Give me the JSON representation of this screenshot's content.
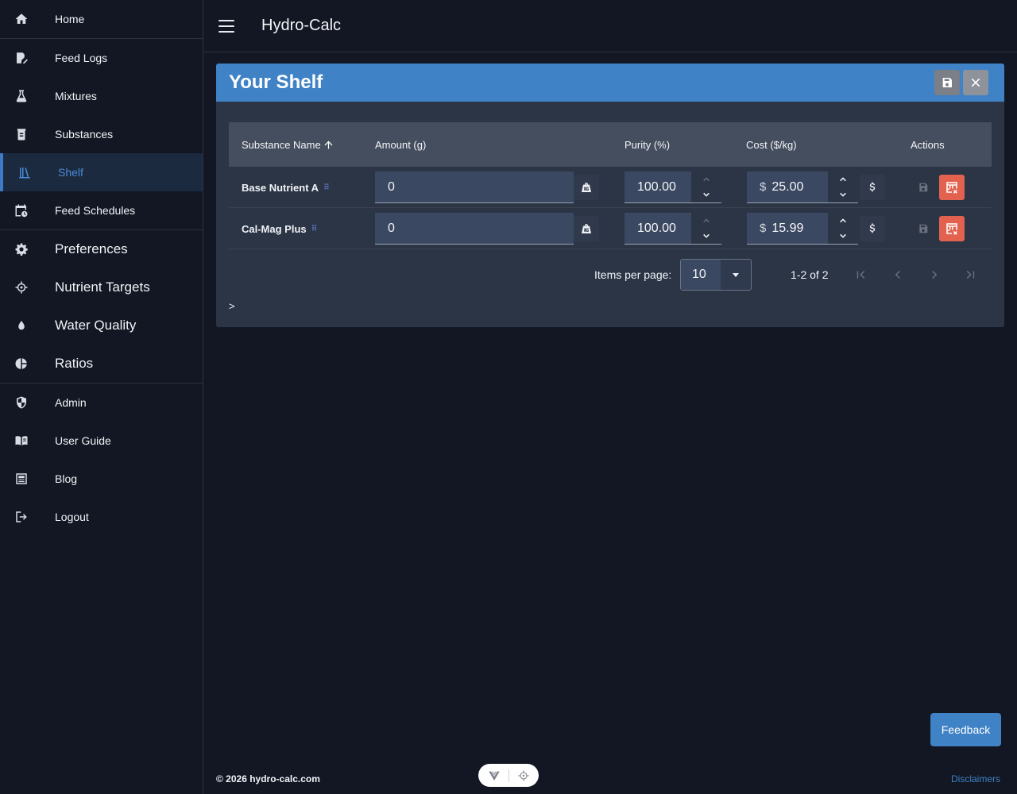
{
  "sidebar": {
    "groups": [
      [
        {
          "label": "Home",
          "icon": "home-icon"
        }
      ],
      [
        {
          "label": "Feed Logs",
          "icon": "feed-logs-icon"
        },
        {
          "label": "Mixtures",
          "icon": "flask-icon"
        },
        {
          "label": "Substances",
          "icon": "jar-icon"
        },
        {
          "label": "Shelf",
          "icon": "shelf-icon",
          "active": true
        },
        {
          "label": "Feed Schedules",
          "icon": "calendar-clock-icon"
        }
      ],
      [
        {
          "label": "Preferences",
          "icon": "gear-icon"
        },
        {
          "label": "Nutrient Targets",
          "icon": "crosshair-icon"
        },
        {
          "label": "Water Quality",
          "icon": "water-drop-icon"
        },
        {
          "label": "Ratios",
          "icon": "pie-chart-icon"
        }
      ],
      [
        {
          "label": "Admin",
          "icon": "shield-icon"
        },
        {
          "label": "User Guide",
          "icon": "book-icon"
        },
        {
          "label": "Blog",
          "icon": "newspaper-icon"
        },
        {
          "label": "Logout",
          "icon": "logout-icon"
        }
      ]
    ]
  },
  "topbar": {
    "title": "Hydro-Calc"
  },
  "panel": {
    "title": "Your Shelf",
    "columns": {
      "name": "Substance Name",
      "amount": "Amount (g)",
      "purity": "Purity (%)",
      "cost": "Cost ($/kg)",
      "actions": "Actions"
    },
    "rows": [
      {
        "name": "Base Nutrient A",
        "amount": "0",
        "purity": "100.00",
        "currency": "$",
        "cost": "25.00"
      },
      {
        "name": "Cal-Mag Plus",
        "amount": "0",
        "purity": "100.00",
        "currency": "$",
        "cost": "15.99"
      }
    ],
    "pager": {
      "items_per_page_label": "Items per page:",
      "items_per_page": "10",
      "range": "1-2 of 2"
    },
    "expander": ">"
  },
  "feedback_label": "Feedback",
  "footer": {
    "copyright": "© 2026 hydro-calc.com",
    "disclaimers": "Disclaimers"
  },
  "colors": {
    "accent": "#3f82c5",
    "danger": "#e2624f",
    "background": "#121723",
    "panel": "#2c3546"
  }
}
